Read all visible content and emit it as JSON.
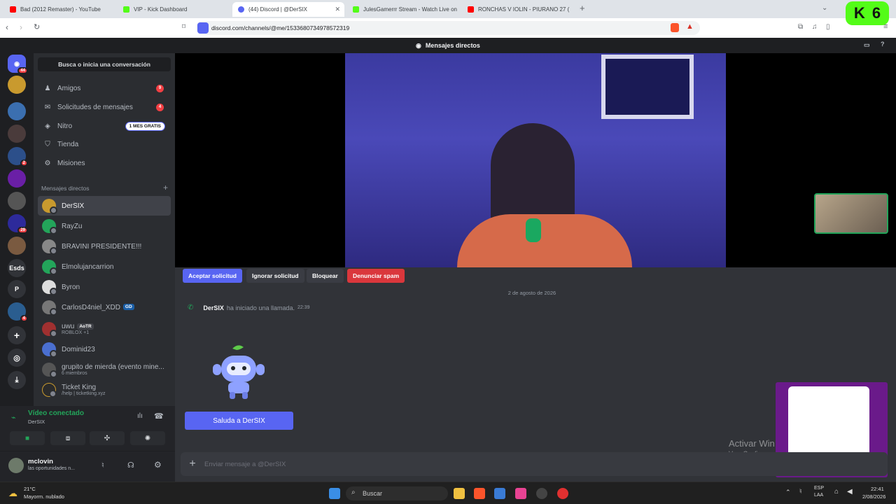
{
  "browser": {
    "tabs": [
      {
        "title": "Bad (2012 Remaster) - YouTube",
        "color": "#ff0000"
      },
      {
        "title": "VIP - Kick Dashboard",
        "color": "#53fc18"
      },
      {
        "title": "(44) Discord | @DerSIX",
        "color": "#5865f2",
        "active": true
      },
      {
        "title": "JulesGamerrr Stream - Watch Live on",
        "color": "#53fc18"
      },
      {
        "title": "RONCHAS V IOLIN - PIURANO 27 (",
        "color": "#ff0000"
      }
    ],
    "url": "discord.com/channels/@me/1533680734978572319",
    "new_tab": "+"
  },
  "header": {
    "title": "Mensajes directos"
  },
  "rail": {
    "home_badge": "44",
    "servers": [
      {
        "label": "",
        "badge": "",
        "color": "#c99a2e"
      },
      {
        "label": "",
        "badge": "",
        "color": "#3b6fb0"
      },
      {
        "label": "",
        "badge": "",
        "color": "#4a3b3b"
      },
      {
        "label": "",
        "badge": "2",
        "color": "#2c4f8a"
      },
      {
        "label": "",
        "badge": "",
        "color": "#6a1fa6"
      },
      {
        "label": "",
        "badge": "",
        "color": "#555"
      },
      {
        "label": "",
        "badge": "29",
        "color": "#2d2a9b"
      },
      {
        "label": "",
        "badge": "",
        "color": "#7a5a40"
      },
      {
        "label": "Esds",
        "badge": "",
        "color": "#313338"
      },
      {
        "label": "P",
        "badge": "",
        "color": "#313338"
      },
      {
        "label": "",
        "badge": "4",
        "color": "#2a5d8f"
      }
    ]
  },
  "sidebar": {
    "search": "Busca o inicia una conversación",
    "nav": [
      {
        "label": "Amigos",
        "count": "9"
      },
      {
        "label": "Solicitudes de mensajes",
        "count": "4"
      },
      {
        "label": "Nitro",
        "pill": "1 MES GRATIS"
      },
      {
        "label": "Tienda"
      },
      {
        "label": "Misiones"
      }
    ],
    "dm_header": "Mensajes directos",
    "dms": [
      {
        "name": "DerSIX",
        "sub": "",
        "tag": "",
        "color": "#c99a2e"
      },
      {
        "name": "RayZu",
        "sub": "",
        "tag": "",
        "color": "#23a55a"
      },
      {
        "name": "BRAVINI PRESIDENTE!!!",
        "sub": "",
        "tag": "",
        "color": "#888"
      },
      {
        "name": "Elmolujancarrion",
        "sub": "",
        "tag": "",
        "color": "#23a55a"
      },
      {
        "name": "Byron",
        "sub": "",
        "tag": "",
        "color": "#ddd"
      },
      {
        "name": "CarlosD4niel_XDD",
        "sub": "",
        "tag": "GD",
        "color": "#777"
      },
      {
        "name": "uwu",
        "sub": "ROBLOX +1",
        "tag": "AoTR",
        "color": "#a03030"
      },
      {
        "name": "Dominid23",
        "sub": "",
        "tag": "",
        "color": "#4a6fd0"
      },
      {
        "name": "grupito de mierda (evento mine...",
        "sub": "6 miembros",
        "tag": "",
        "color": "#555"
      },
      {
        "name": "Ticket King",
        "sub": "/help | ticketking.xyz",
        "tag": "",
        "color": "#2b2b2b"
      }
    ]
  },
  "voice": {
    "status": "Vídeo conectado",
    "channel": "DerSIX"
  },
  "user": {
    "name": "mclovin",
    "status": "las oportunidades n..."
  },
  "request_bar": {
    "accept": "Aceptar solicitud",
    "ignore": "Ignorar solicitud",
    "block": "Bloquear",
    "spam": "Denunciar spam"
  },
  "chat": {
    "date": "2 de agosto de 2026",
    "caller": "DerSIX",
    "call_text": "ha iniciado una llamada.",
    "call_time": "22:39",
    "hello_button": "Saluda a DerSIX",
    "placeholder": "Enviar mensaje a @DerSIX"
  },
  "watermark": {
    "line1": "Activar Win",
    "line2": "Ve a Configura"
  },
  "overlay": {
    "kick_count": "6"
  },
  "taskbar": {
    "weather_temp": "21°C",
    "weather_desc": "Mayorm. nublado",
    "search": "Buscar",
    "lang1": "ESP",
    "lang2": "LAA",
    "time": "22:41",
    "date": "2/08/2026"
  },
  "colors": {
    "blurple": "#5865f2",
    "danger": "#da373c",
    "green": "#23a55a"
  }
}
